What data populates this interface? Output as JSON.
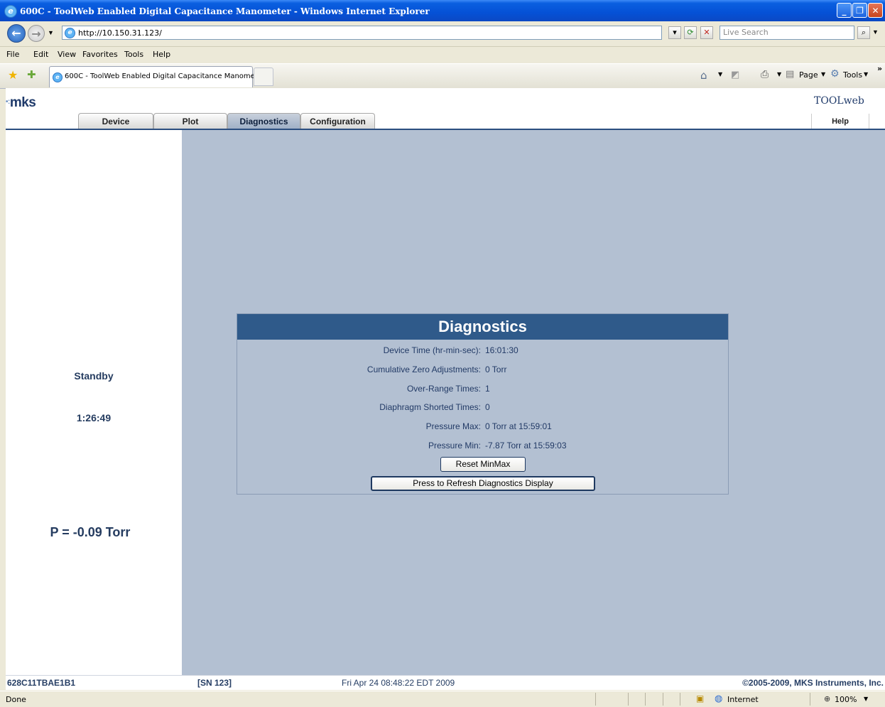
{
  "window": {
    "title": "600C - ToolWeb Enabled Digital Capacitance Manometer - Windows Internet Explorer",
    "minimize": "_",
    "maximize": "❐",
    "close": "✕"
  },
  "addressbar": {
    "url": "http://10.150.31.123/",
    "search_placeholder": "Live Search"
  },
  "menu": [
    "File",
    "Edit",
    "View",
    "Favorites",
    "Tools",
    "Help"
  ],
  "browser_tab": {
    "label": "600C - ToolWeb Enabled Digital Capacitance Manometer"
  },
  "command_bar": {
    "page_label": "Page",
    "tools_label": "Tools"
  },
  "page": {
    "logo": "mks",
    "toolweb": "TOOLweb",
    "tabs": [
      "Device",
      "Plot",
      "Diagnostics",
      "Configuration"
    ],
    "active_tab": "Diagnostics",
    "help": "Help",
    "left": {
      "status": "Standby",
      "time": "1:26:49",
      "pressure": "P = -0.09 Torr"
    },
    "diagnostics": {
      "title": "Diagnostics",
      "rows": [
        {
          "label": "Device Time (hr-min-sec):",
          "value": "16:01:30"
        },
        {
          "label": "Cumulative Zero Adjustments:",
          "value": "0 Torr"
        },
        {
          "label": "Over-Range Times:",
          "value": "1"
        },
        {
          "label": "Diaphragm Shorted Times:",
          "value": "0"
        },
        {
          "label": "Pressure Max:",
          "value": "0 Torr at 15:59:01"
        },
        {
          "label": "Pressure Min:",
          "value": "-7.87 Torr at 15:59:03"
        }
      ],
      "reset_button": "Reset MinMax",
      "refresh_button": "Press to Refresh Diagnostics Display"
    },
    "footer": {
      "model": "628C11TBAE1B1",
      "serial": "[SN 123]",
      "date": "Fri Apr 24 08:48:22 EDT 2009",
      "copyright": "©2005-2009, MKS Instruments, Inc."
    }
  },
  "statusbar": {
    "status": "Done",
    "zone": "Internet",
    "zoom": "100%"
  },
  "colors": {
    "ie_titlebar": "#0551d6",
    "page_background": "#b3c0d2",
    "panel_header": "#2f5a8a",
    "text_blue": "#223a66"
  }
}
